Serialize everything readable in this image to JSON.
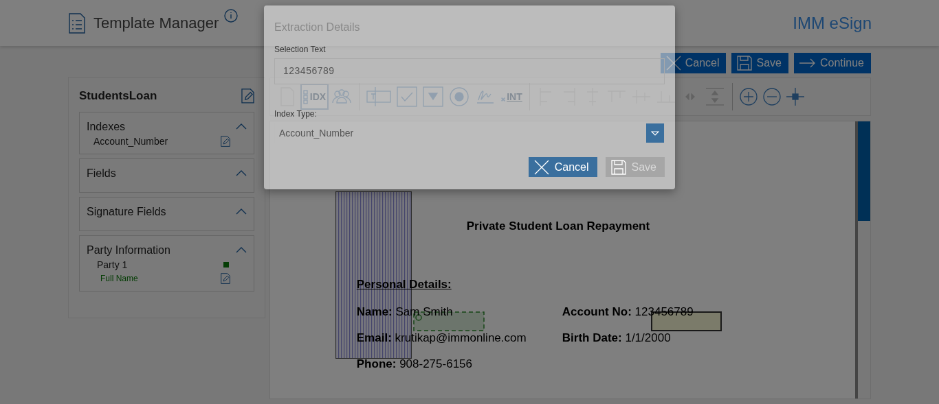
{
  "header": {
    "title": "Template Manager",
    "brand": "IMM eSign"
  },
  "actions": [
    {
      "label": "Cancel",
      "kind": "cancel"
    },
    {
      "label": "Save",
      "kind": "save"
    },
    {
      "label": "Continue",
      "kind": "continue"
    }
  ],
  "template": {
    "name": "StudentsLoan",
    "sections": [
      {
        "title": "Indexes",
        "expanded": true,
        "items": [
          {
            "kind": "index",
            "label": "Account_Number"
          }
        ]
      },
      {
        "title": "Fields",
        "expanded": true
      },
      {
        "title": "Signature Fields",
        "expanded": true
      },
      {
        "title": "Party Information",
        "expanded": true,
        "items": [
          {
            "kind": "party",
            "label": "Party 1",
            "children": [
              {
                "label": "Full Name"
              }
            ]
          }
        ]
      }
    ]
  },
  "toolbar": {
    "tools": [
      {
        "kind": "document",
        "selected": false,
        "disabled": true
      },
      {
        "kind": "index",
        "label": "IDX",
        "selected": true,
        "disabled": false
      },
      {
        "kind": "parties",
        "selected": false,
        "disabled": false
      },
      {
        "kind": "separator"
      },
      {
        "kind": "text_field",
        "selected": false,
        "disabled": false
      },
      {
        "kind": "checkbox",
        "selected": false,
        "disabled": false
      },
      {
        "kind": "dropdown",
        "selected": false,
        "disabled": false
      },
      {
        "kind": "radio",
        "selected": false,
        "disabled": false
      },
      {
        "kind": "signature",
        "selected": false,
        "disabled": false
      },
      {
        "kind": "initials",
        "label": "INT",
        "selected": false,
        "disabled": false
      },
      {
        "kind": "separator"
      },
      {
        "kind": "align_left",
        "selected": false,
        "disabled": true
      },
      {
        "kind": "align_right",
        "selected": false,
        "disabled": true
      },
      {
        "kind": "align_center",
        "selected": false,
        "disabled": true
      },
      {
        "kind": "align_top",
        "selected": false,
        "disabled": true
      },
      {
        "kind": "align_middle",
        "selected": false,
        "disabled": true
      },
      {
        "kind": "align_bottom",
        "selected": false,
        "disabled": true
      },
      {
        "kind": "arrows",
        "selected": false,
        "disabled": true
      },
      {
        "kind": "same_height",
        "selected": false,
        "disabled": true
      },
      {
        "kind": "separator"
      },
      {
        "kind": "zoom_in",
        "selected": false,
        "disabled": false
      },
      {
        "kind": "zoom_out",
        "selected": false,
        "disabled": false
      },
      {
        "kind": "move",
        "selected": false,
        "disabled": false
      }
    ]
  },
  "document": {
    "heading": "Private Student Loan Repayment",
    "section": "Personal Details:",
    "lines": [
      [
        {
          "label": "Name:",
          "value": "Sam Smith"
        },
        {
          "label": "Account No:",
          "value": "123456789"
        }
      ],
      [
        {
          "label": "Email:",
          "value": "krutikap@immonline.com"
        },
        {
          "label": "Birth Date:",
          "value": "1/1/2000"
        }
      ],
      [
        {
          "label": "Phone:",
          "value": "908-275-6156"
        }
      ]
    ],
    "annotations": [
      {
        "kind": "hatch"
      },
      {
        "kind": "party_field"
      },
      {
        "kind": "index_field"
      }
    ]
  },
  "dialog": {
    "title": "Extraction Details",
    "selection_label": "Selection Text",
    "selection_value": "123456789",
    "index_label": "Index Type:",
    "index_value": "Account_Number",
    "buttons": [
      {
        "label": "Cancel",
        "kind": "cancel",
        "disabled": false
      },
      {
        "label": "Save",
        "kind": "save",
        "disabled": true
      }
    ]
  }
}
